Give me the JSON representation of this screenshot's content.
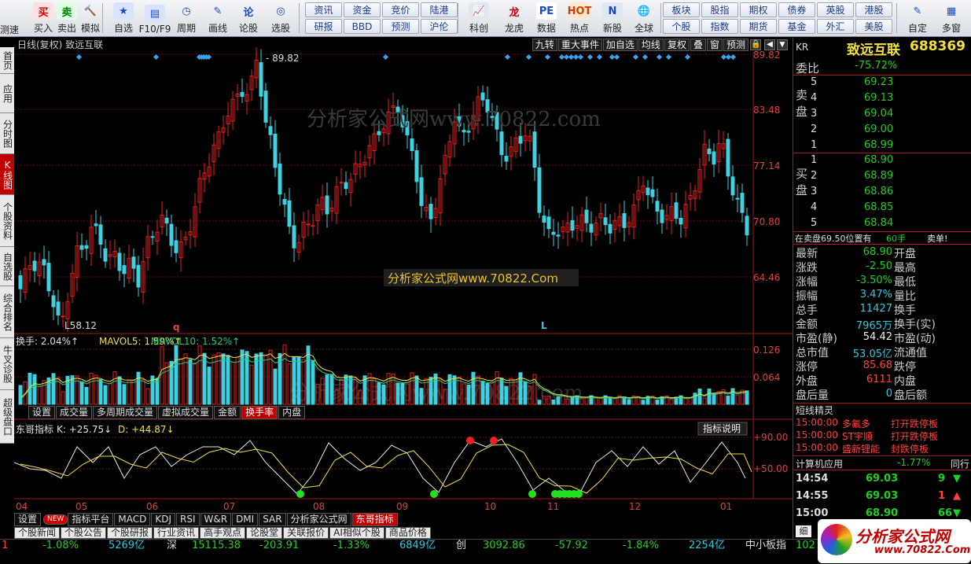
{
  "toolbar": {
    "buttons": [
      {
        "label": "买入",
        "name": "buy-button",
        "icon": "买",
        "bg": "#ffe0e0",
        "fg": "#d00000"
      },
      {
        "label": "卖出",
        "name": "sell-button",
        "icon": "卖",
        "bg": "#e0ffe0",
        "fg": "#008000"
      },
      {
        "label": "模拟",
        "name": "simulate-button",
        "icon": "🔨",
        "bg": "transparent",
        "fg": "#a05000"
      },
      {
        "label": "自选",
        "name": "watchlist-button",
        "icon": "★",
        "bg": "#d8e4ff",
        "fg": "#1a4ac0"
      },
      {
        "label": "F10/F9",
        "name": "f10-button",
        "icon": "▤",
        "bg": "#d8e4ff",
        "fg": "#1a4ac0"
      },
      {
        "label": "周期",
        "name": "period-button",
        "icon": "◷",
        "bg": "transparent",
        "fg": "#1a4ac0"
      },
      {
        "label": "画线",
        "name": "drawline-button",
        "icon": "✎",
        "bg": "transparent",
        "fg": "#1a4ac0"
      },
      {
        "label": "论股",
        "name": "discuss-button",
        "icon": "论",
        "bg": "transparent",
        "fg": "#1a4ac0"
      },
      {
        "label": "选股",
        "name": "pick-stock-button",
        "icon": "◎",
        "bg": "transparent",
        "fg": "#1a4ac0"
      },
      {
        "label": "科创",
        "name": "star-market-button",
        "icon": "📈",
        "bg": "#e0e8f4",
        "fg": "#c00000"
      },
      {
        "label": "龙虎",
        "name": "dragon-tiger-button",
        "icon": "龙",
        "bg": "transparent",
        "fg": "#d00000"
      },
      {
        "label": "数据",
        "name": "data-button",
        "icon": "PE",
        "bg": "#ffffff",
        "fg": "#1a4ac0"
      },
      {
        "label": "热点",
        "name": "hotspot-button",
        "icon": "HOT",
        "bg": "#ffe8d0",
        "fg": "#d04000"
      },
      {
        "label": "新股",
        "name": "ipo-button",
        "icon": "N",
        "bg": "#e0e8f4",
        "fg": "#1a4ac0"
      },
      {
        "label": "全球",
        "name": "global-button",
        "icon": "🌐",
        "bg": "transparent",
        "fg": "#1a4ac0"
      },
      {
        "label": "自定",
        "name": "custom-button",
        "icon": "✎",
        "bg": "transparent",
        "fg": "#1a4ac0"
      },
      {
        "label": "多窗",
        "name": "multiwindow-button",
        "icon": "▦",
        "bg": "transparent",
        "fg": "#1a4ac0"
      }
    ],
    "small": [
      [
        "资讯",
        "资金",
        "竞价",
        "陆港"
      ],
      [
        "研报",
        "BBD",
        "预测",
        "沪伦"
      ],
      [
        "板块",
        "股指",
        "期权",
        "债券",
        "英股",
        "港股"
      ],
      [
        "个股",
        "指数",
        "期货",
        "基金",
        "外汇",
        "美股"
      ]
    ],
    "corner": "测速"
  },
  "leftnav": [
    {
      "label": "首页",
      "active": false,
      "h": 34
    },
    {
      "label": "应用",
      "active": false,
      "h": 50
    },
    {
      "label": "分时图",
      "active": false,
      "h": 52
    },
    {
      "label": "K线图",
      "active": true,
      "h": 52
    },
    {
      "label": "个股资料",
      "active": false,
      "h": 66
    },
    {
      "label": "自选股",
      "active": false,
      "h": 50
    },
    {
      "label": "综合排名",
      "active": false,
      "h": 66
    },
    {
      "label": "牛叉诊股",
      "active": false,
      "h": 66
    },
    {
      "label": "超级盘口",
      "active": false,
      "h": 68
    }
  ],
  "chart": {
    "title": "日线(复权) 致远互联",
    "tabs": [
      "九转",
      "重大事件",
      "加自选",
      "均线",
      "复权",
      "叠",
      "窗",
      "预测"
    ],
    "price_axis": [
      "89.82",
      "83.48",
      "77.14",
      "70.80",
      "64.46"
    ],
    "max_label": "89.82",
    "min_label": "58.12",
    "marker_q": "q",
    "marker_L": "L",
    "watermark": "分析家公式网www.70822.com",
    "watermark2": "分析家公式网www.70822.Com",
    "vol_info": {
      "a": "换手: 2.04%↑",
      "b": "MAVOL5: 1.59%↑",
      "c": "MAVOL10: 1.52%↑"
    },
    "vol_axis": [
      "0.126",
      "0.064"
    ],
    "subtabs": [
      "设置",
      "成交量",
      "多周期成交量",
      "虚拟成交量",
      "金额",
      "换手率",
      "内盘"
    ],
    "ind_title": "东哥指标",
    "ind_k": "K: +25.75↓",
    "ind_d": "D: +44.87↓",
    "ind_axis": [
      "+90.00",
      "+50.00"
    ],
    "ind_explain": "指标说明",
    "months": [
      "04",
      "05",
      "06",
      "07",
      "08",
      "09",
      "10",
      "11",
      "12",
      "01"
    ],
    "indtabs": [
      "设置",
      "NEW",
      "指标平台",
      "MACD",
      "KDJ",
      "RSI",
      "W&R",
      "DMI",
      "SAR",
      "分析家公式网",
      "东哥指标"
    ],
    "bottomtabs": [
      "个股新闻",
      "个股公告",
      "个股研报",
      "行业资讯",
      "高手观点",
      "论股堂",
      "关联报价",
      "AI相似个股",
      "商品价格"
    ]
  },
  "panel": {
    "kr": "KR",
    "name": "致远互联",
    "code": "688369",
    "webi_label": "委比",
    "webi": "-75.72%",
    "sell_label": "卖盘",
    "buy_label": "买盘",
    "sell": [
      [
        "5",
        "69.23"
      ],
      [
        "4",
        "69.13"
      ],
      [
        "3",
        "69.04"
      ],
      [
        "2",
        "69.00"
      ],
      [
        "1",
        "68.99"
      ]
    ],
    "buy": [
      [
        "1",
        "68.90"
      ],
      [
        "2",
        "68.89"
      ],
      [
        "3",
        "68.86"
      ],
      [
        "4",
        "68.85"
      ],
      [
        "5",
        "68.84"
      ]
    ],
    "note": "在卖盘69.50位置有",
    "note_v": "60手",
    "note_t": "卖单!",
    "stats": [
      [
        "最新",
        "68.90",
        "开盘",
        "green"
      ],
      [
        "涨跌",
        "-2.50",
        "最高",
        "green"
      ],
      [
        "涨幅",
        "-3.50%",
        "最低",
        "green"
      ],
      [
        "振幅",
        "3.47%",
        "量比",
        "cyan"
      ],
      [
        "总手",
        "11427",
        "换手",
        "cyan"
      ],
      [
        "金额",
        "7965万",
        "换手(实)",
        "cyan"
      ],
      [
        "市盈(静)",
        "54.42",
        "市盈(动)",
        "white"
      ],
      [
        "总市值",
        "53.05亿",
        "流通值",
        "cyan"
      ],
      [
        "涨停",
        "85.68",
        "跌停",
        "red"
      ],
      [
        "外盘",
        "6111",
        "内盘",
        "red"
      ],
      [
        "盘后量",
        "0",
        "盘后额",
        "cyan"
      ]
    ],
    "sprite_title": "短线精灵",
    "sprites": [
      [
        "15:00:00",
        "多氟多",
        "打开跌停板"
      ],
      [
        "15:00:00",
        "ST宇顺",
        "打开跌停板"
      ],
      [
        "15:00:00",
        "盛新锂能",
        "封跌停板"
      ]
    ],
    "industry": "计算机应用",
    "industry_v": "-1.77%",
    "industry_t": "同行",
    "ticks": [
      [
        "14:54",
        "69.03",
        "9",
        "down"
      ],
      [
        "14:55",
        "69.03",
        "1",
        "up"
      ],
      [
        "15:00",
        "68.90",
        "66",
        "down"
      ]
    ],
    "detail": "细"
  },
  "status": [
    {
      "t": "1",
      "c": "#ff4040"
    },
    {
      "t": "-1.08%",
      "c": "#20d020"
    },
    {
      "t": "5269亿",
      "c": "#30c8e0"
    },
    {
      "t": "深",
      "c": "#ddd"
    },
    {
      "t": "15115.38",
      "c": "#20d020"
    },
    {
      "t": "-203.91",
      "c": "#20d020"
    },
    {
      "t": "-1.33%",
      "c": "#20d020"
    },
    {
      "t": "6849亿",
      "c": "#30c8e0"
    },
    {
      "t": "创",
      "c": "#ddd"
    },
    {
      "t": "3092.86",
      "c": "#20d020"
    },
    {
      "t": "-57.92",
      "c": "#20d020"
    },
    {
      "t": "-1.84%",
      "c": "#20d020"
    },
    {
      "t": "2254亿",
      "c": "#30c8e0"
    },
    {
      "t": "中小板指",
      "c": "#ddd"
    },
    {
      "t": "102",
      "c": "#20d020"
    }
  ],
  "logo": {
    "text": "分析家公式网",
    "sub": "www.70822.Com"
  }
}
